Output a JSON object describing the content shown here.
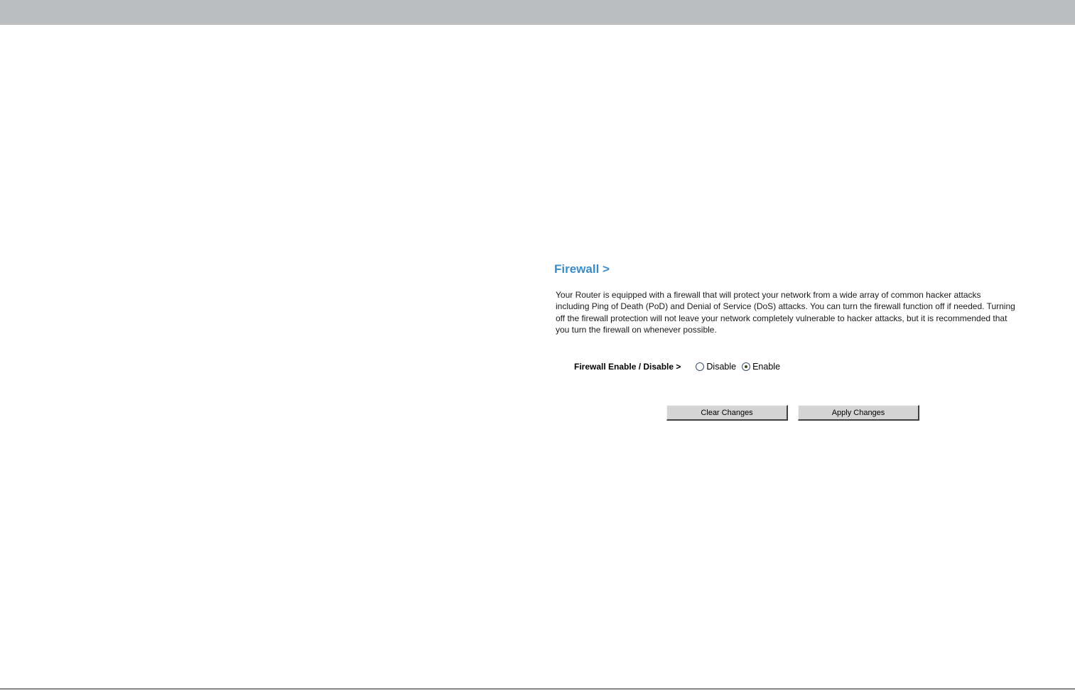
{
  "page": {
    "title": "Firewall >",
    "description": "Your Router is equipped with a firewall that will protect your network from a wide array of common hacker attacks including Ping of Death (PoD) and Denial of Service (DoS) attacks. You can turn the firewall function off if needed. Turning off the firewall protection will not leave your network completely vulnerable to hacker attacks, but it is recommended that you turn the firewall on whenever possible."
  },
  "firewall_setting": {
    "label": "Firewall Enable / Disable >",
    "options": [
      {
        "label": "Disable",
        "selected": false
      },
      {
        "label": "Enable",
        "selected": true
      }
    ]
  },
  "buttons": {
    "clear_label": "Clear Changes",
    "apply_label": "Apply Changes"
  },
  "colors": {
    "title": "#3a8cc8",
    "top_bar": "#bcbdc0",
    "button_face": "#d4d4d4"
  }
}
